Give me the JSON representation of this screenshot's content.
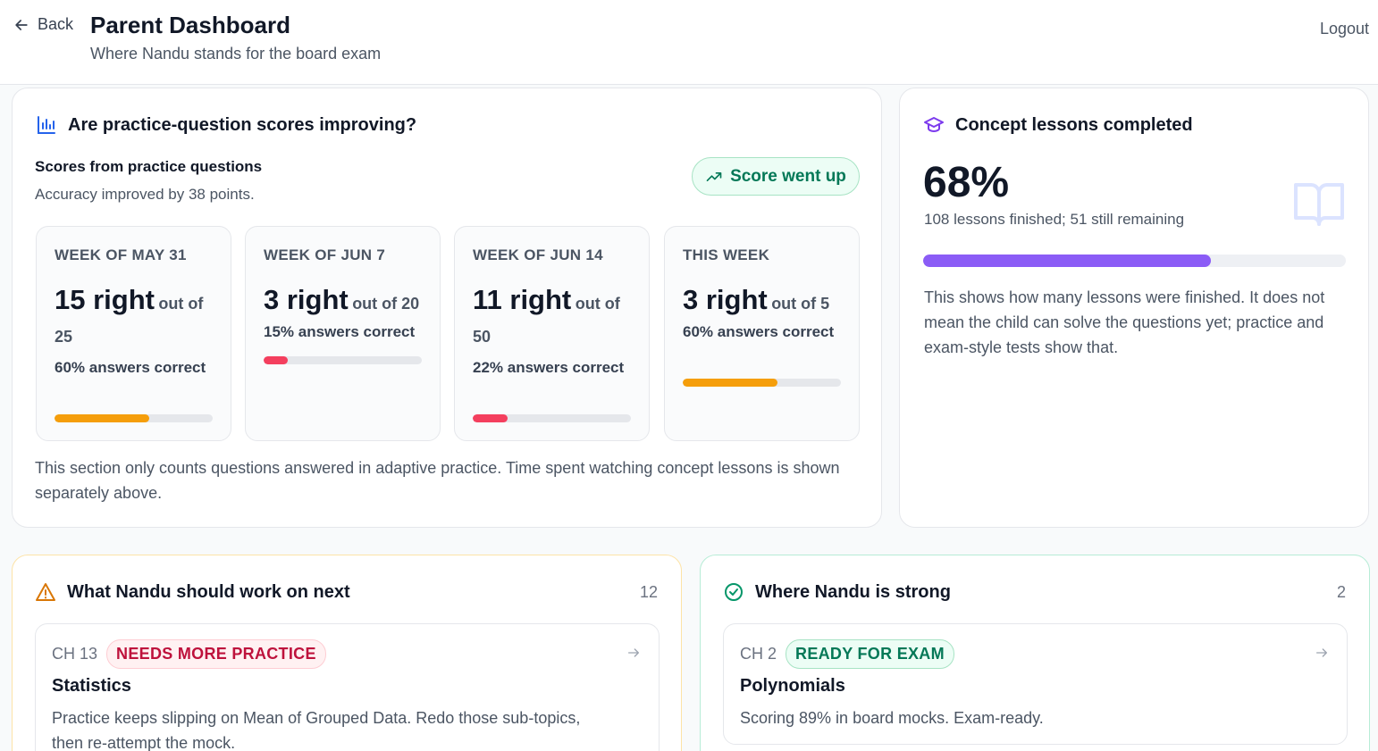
{
  "header": {
    "back_label": "Back",
    "title": "Parent Dashboard",
    "subtitle": "Where Nandu stands for the board exam",
    "logout_label": "Logout"
  },
  "practice": {
    "title": "Are practice-question scores improving?",
    "subtitle": "Scores from practice questions",
    "accuracy_note": "Accuracy improved by 38 points.",
    "trend_label": "Score went up",
    "weeks": [
      {
        "label": "WEEK OF MAY 31",
        "right": "15 right",
        "out_of": "out of",
        "total": "25",
        "pct_text": "60% answers correct",
        "fraction": 0.6,
        "color": "#f59e0b"
      },
      {
        "label": "WEEK OF JUN 7",
        "right": "3 right",
        "out_of": "out of 20",
        "total": "",
        "pct_text": "15% answers correct",
        "fraction": 0.15,
        "color": "#f43f5e"
      },
      {
        "label": "WEEK OF JUN 14",
        "right": "11 right",
        "out_of": "out of",
        "total": "50",
        "pct_text": "22% answers correct",
        "fraction": 0.22,
        "color": "#f43f5e"
      },
      {
        "label": "THIS WEEK",
        "right": "3 right",
        "out_of": "out of 5",
        "total": "",
        "pct_text": "60% answers correct",
        "fraction": 0.6,
        "color": "#f59e0b"
      }
    ],
    "footnote": "This section only counts questions answered in adaptive practice. Time spent watching concept lessons is shown separately above."
  },
  "concept": {
    "title": "Concept lessons completed",
    "percent": "68%",
    "fraction": 0.68,
    "detail": "108 lessons finished; 51 still remaining",
    "note": "This shows how many lessons were finished. It does not mean the child can solve the questions yet; practice and exam-style tests show that.",
    "bar_color": "#8b5cf6"
  },
  "work_next": {
    "title": "What Nandu should work on next",
    "count": "12",
    "item": {
      "chapter": "CH 13",
      "badge": "NEEDS MORE PRACTICE",
      "title": "Statistics",
      "desc": "Practice keeps slipping on Mean of Grouped Data. Redo those sub-topics, then re-attempt the mock."
    }
  },
  "strong": {
    "title": "Where Nandu is strong",
    "count": "2",
    "item": {
      "chapter": "CH 2",
      "badge": "READY FOR EXAM",
      "title": "Polynomials",
      "desc": "Scoring 89% in board mocks. Exam-ready."
    }
  }
}
